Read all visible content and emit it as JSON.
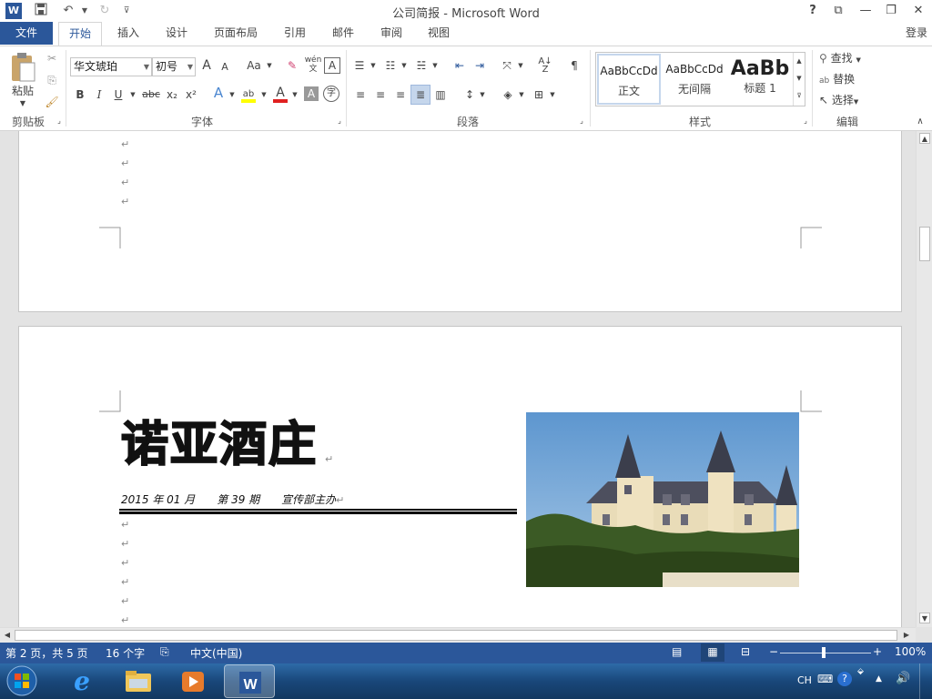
{
  "titlebar": {
    "title": "公司简报 - Microsoft Word",
    "help": "?",
    "login": "登录"
  },
  "tabs": [
    "文件",
    "开始",
    "插入",
    "设计",
    "页面布局",
    "引用",
    "邮件",
    "审阅",
    "视图"
  ],
  "ribbon": {
    "clipboard": {
      "paste": "粘贴",
      "label": "剪贴板"
    },
    "font": {
      "name": "华文琥珀",
      "size": "初号",
      "label": "字体",
      "phonetic": "wén",
      "bold": "B",
      "italic": "I",
      "underline": "U",
      "strike": "abc",
      "sub": "x₂",
      "sup": "x²",
      "grow": "A",
      "shrink": "A",
      "case": "Aa",
      "color_red": "#e02020",
      "highlight": "#ffff00"
    },
    "paragraph": {
      "label": "段落"
    },
    "styles": {
      "label": "样式",
      "items": [
        {
          "preview": "AaBbCcDd",
          "name": "正文"
        },
        {
          "preview": "AaBbCcDd",
          "name": "无间隔"
        },
        {
          "preview": "AaBb",
          "name": "标题 1"
        }
      ]
    },
    "editing": {
      "find": "查找",
      "replace": "替换",
      "select": "选择",
      "label": "编辑"
    }
  },
  "document": {
    "title": "诺亚酒庄",
    "info_line": "2015 年 01 月　　第 39 期　　宣传部主办"
  },
  "status": {
    "page": "第 2 页，共 5 页",
    "words": "16 个字",
    "lang": "中文(中国)",
    "zoom": "100%"
  },
  "taskbar": {
    "ime": "CH"
  },
  "colors": {
    "accent": "#2b579a",
    "status": "#2b579a"
  }
}
